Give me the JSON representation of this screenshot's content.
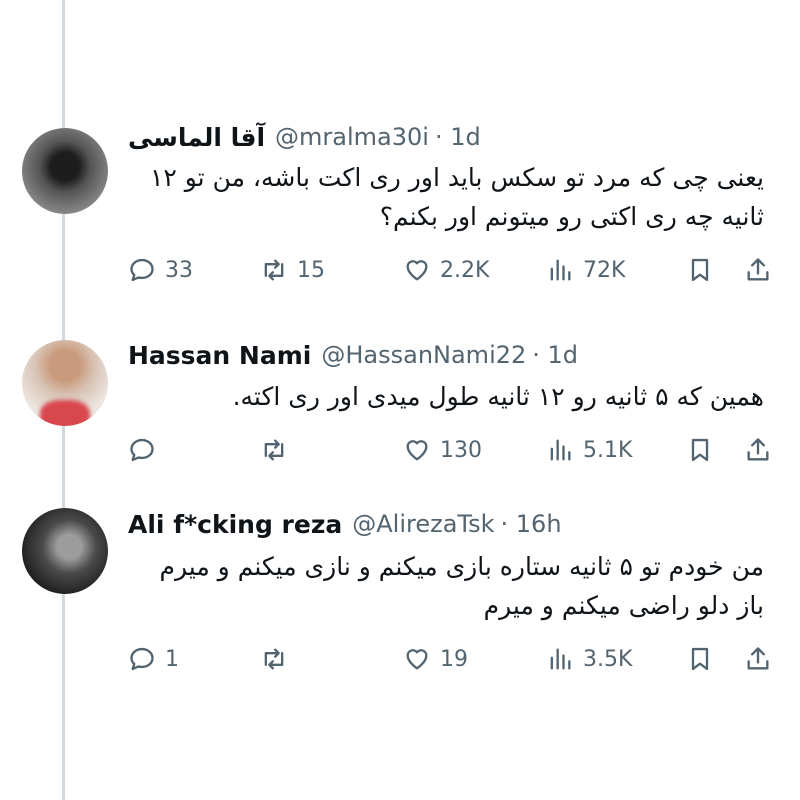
{
  "replies": [
    {
      "name": "آقا الماسی",
      "handle": "@mralma30i",
      "time": "· 1d",
      "text": "یعنی چی که مرد تو سکس باید اور ری اکت باشه، من تو ۱۲ ثانیه چه ری اکتی رو میتونم اور بکنم؟",
      "replies": "33",
      "retweets": "15",
      "likes": "2.2K",
      "views": "72K"
    },
    {
      "name": "Hassan Nami",
      "handle": "@HassanNami22",
      "time": "· 1d",
      "text": "همین که ۵ ثانیه رو ۱۲ ثانیه طول میدی اور ری اکته.",
      "replies": "",
      "retweets": "",
      "likes": "130",
      "views": "5.1K"
    },
    {
      "name": "Ali f*cking reza",
      "handle": "@AlirezaTsk",
      "time": "· 16h",
      "text": "من خودم تو ۵ ثانیه ستاره بازی میکنم و نازی میکنم و میرم باز دلو راضی میکنم و میرم",
      "replies": "1",
      "retweets": "",
      "likes": "19",
      "views": "3.5K"
    }
  ]
}
